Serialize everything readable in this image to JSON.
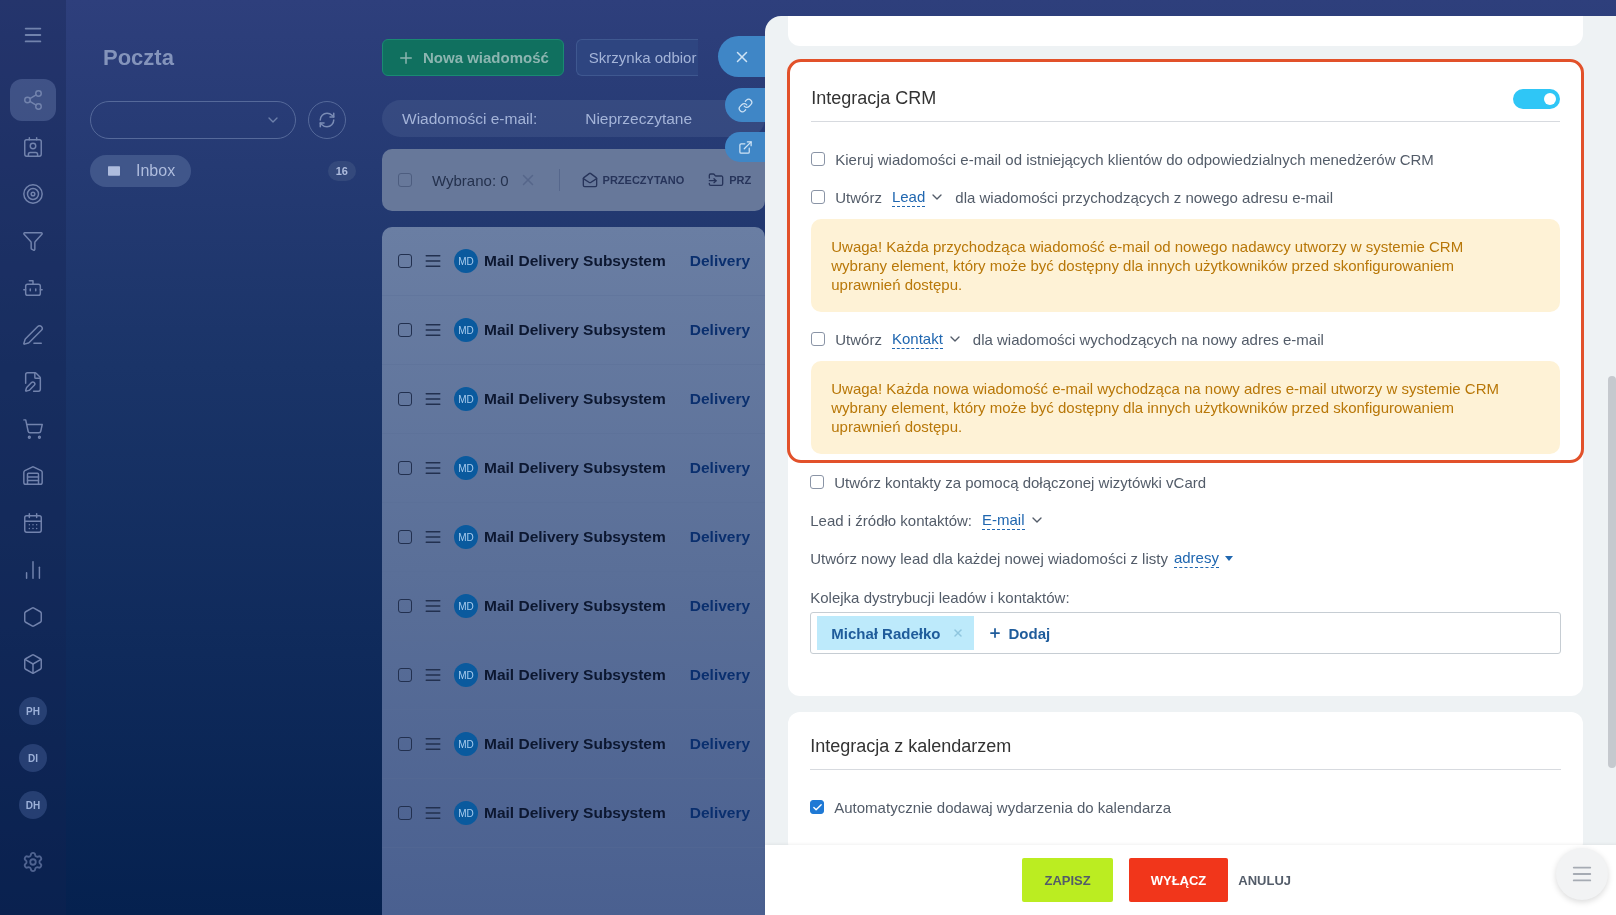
{
  "sidebar": {
    "items": [
      {
        "kind": "icon",
        "selected": true
      },
      {
        "kind": "icon",
        "selected": false
      },
      {
        "kind": "icon",
        "selected": false
      },
      {
        "kind": "icon",
        "selected": false
      },
      {
        "kind": "icon",
        "selected": false
      },
      {
        "kind": "icon",
        "selected": false
      },
      {
        "kind": "icon",
        "selected": false
      },
      {
        "kind": "icon",
        "selected": false
      },
      {
        "kind": "icon",
        "selected": false
      },
      {
        "kind": "icon",
        "selected": false
      },
      {
        "kind": "icon",
        "selected": false
      },
      {
        "kind": "icon",
        "selected": false
      },
      {
        "kind": "icon",
        "selected": false
      },
      {
        "kind": "avatar",
        "label": "PH",
        "selected": false
      },
      {
        "kind": "avatar",
        "label": "DI",
        "selected": false
      },
      {
        "kind": "avatar",
        "label": "DH",
        "selected": false
      }
    ]
  },
  "mail": {
    "title": "Poczta",
    "new_message_button": "Nowa wiadomość",
    "mailbox_button": "Skrzynka odbior",
    "folders": [
      {
        "label": "Inbox",
        "count": "16",
        "selected": false
      }
    ],
    "filter": {
      "label": "Wiadomości e-mail:",
      "option": "Nieprzeczytane"
    },
    "toolbar": {
      "selected_count": "Wybrano: 0",
      "checked": false,
      "actions": [
        "PRZECZYTANO",
        "PRZ"
      ]
    },
    "rows": [
      {
        "avatar": "MD",
        "sender": "Mail Delivery Subsystem",
        "subject": "Delivery",
        "checked": false
      },
      {
        "avatar": "MD",
        "sender": "Mail Delivery Subsystem",
        "subject": "Delivery",
        "checked": false
      },
      {
        "avatar": "MD",
        "sender": "Mail Delivery Subsystem",
        "subject": "Delivery",
        "checked": false
      },
      {
        "avatar": "MD",
        "sender": "Mail Delivery Subsystem",
        "subject": "Delivery",
        "checked": false
      },
      {
        "avatar": "MD",
        "sender": "Mail Delivery Subsystem",
        "subject": "Delivery",
        "checked": false
      },
      {
        "avatar": "MD",
        "sender": "Mail Delivery Subsystem",
        "subject": "Delivery",
        "checked": false
      },
      {
        "avatar": "MD",
        "sender": "Mail Delivery Subsystem",
        "subject": "Delivery",
        "checked": false
      },
      {
        "avatar": "MD",
        "sender": "Mail Delivery Subsystem",
        "subject": "Delivery",
        "checked": false
      },
      {
        "avatar": "MD",
        "sender": "Mail Delivery Subsystem",
        "subject": "Delivery",
        "checked": false
      }
    ]
  },
  "crm": {
    "title": "Integracja CRM",
    "enabled": true,
    "highlighted": true,
    "items": [
      {
        "kind": "checkbox",
        "checked": false,
        "label": "Kieruj wiadomości e-mail od istniejących klientów do odpowiedzialnych menedżerów CRM"
      },
      {
        "kind": "checkbox_select",
        "checked": false,
        "before": "Utwórz",
        "value": "Lead",
        "after": "dla wiadomości przychodzących z nowego adresu e-mail"
      },
      {
        "kind": "notice",
        "text": "Uwaga! Każda przychodząca wiadomość e-mail od nowego nadawcy utworzy w systemie CRM wybrany element, który może być dostępny dla innych użytkowników przed skonfigurowaniem uprawnień dostępu."
      },
      {
        "kind": "checkbox_select",
        "checked": false,
        "before": "Utwórz",
        "value": "Kontakt",
        "after": "dla wiadomości wychodzących na nowy adres e-mail"
      },
      {
        "kind": "notice",
        "text": "Uwaga! Każda nowa wiadomość e-mail wychodząca na nowy adres e-mail utworzy w systemie CRM wybrany element, który może być dostępny dla innych użytkowników przed skonfigurowaniem uprawnień dostępu."
      }
    ]
  },
  "crm_more": {
    "items": [
      {
        "kind": "checkbox",
        "checked": false,
        "label": "Utwórz kontakty za pomocą dołączonej wizytówki vCard"
      },
      {
        "kind": "select",
        "label": "Lead i źródło kontaktów:",
        "value": "E-mail"
      },
      {
        "kind": "dropdown_link",
        "label": "Utwórz nowy lead dla każdej nowej wiadomości z listy",
        "value": "adresy"
      },
      {
        "kind": "people_field",
        "label": "Kolejka dystrybucji leadów i kontaktów:",
        "people": [
          "Michał Radełko"
        ],
        "add": "Dodaj"
      }
    ]
  },
  "calendar": {
    "title": "Integracja z kalendarzem",
    "items": [
      {
        "kind": "checkbox",
        "checked": true,
        "label": "Automatycznie dodawaj wydarzenia do kalendarza"
      }
    ]
  },
  "footer": {
    "buttons": [
      {
        "kind": "save",
        "label": "ZAPISZ"
      },
      {
        "kind": "danger",
        "label": "WYŁĄCZ"
      },
      {
        "kind": "link",
        "label": "ANULUJ"
      }
    ]
  }
}
